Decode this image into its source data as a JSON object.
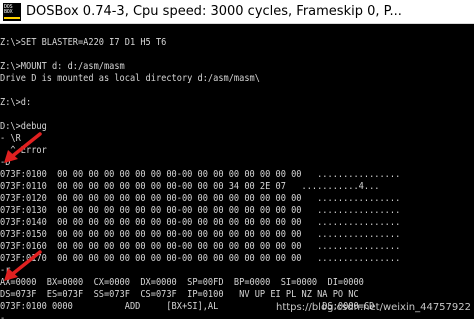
{
  "window": {
    "icon_label_top": "DOS",
    "icon_label_bottom": "BOX",
    "title": "DOSBox 0.74-3, Cpu speed:     3000 cycles, Frameskip  0, P..."
  },
  "console": {
    "lines": [
      "",
      "Z:\\>SET BLASTER=A220 I7 D1 H5 T6",
      "",
      "Z:\\>MOUNT d: d:/asm/masm",
      "Drive D is mounted as local directory d:/asm/masm\\",
      "",
      "Z:\\>d:",
      "",
      "D:\\>debug",
      "- \\R",
      "  ^ Error",
      "-D",
      "073F:0100  00 00 00 00 00 00 00 00-00 00 00 00 00 00 00 00   ................",
      "073F:0110  00 00 00 00 00 00 00 00-00 00 00 34 00 2E 07   ...........4...",
      "073F:0120  00 00 00 00 00 00 00 00-00 00 00 00 00 00 00 00   ................",
      "073F:0130  00 00 00 00 00 00 00 00-00 00 00 00 00 00 00 00   ................",
      "073F:0140  00 00 00 00 00 00 00 00-00 00 00 00 00 00 00 00   ................",
      "073F:0150  00 00 00 00 00 00 00 00-00 00 00 00 00 00 00 00   ................",
      "073F:0160  00 00 00 00 00 00 00 00-00 00 00 00 00 00 00 00   ................",
      "073F:0170  00 00 00 00 00 00 00 00-00 00 00 00 00 00 00 00   ................",
      "-r",
      "AX=0000  BX=0000  CX=0000  DX=0000  SP=00FD  BP=0000  SI=0000  DI=0000",
      "DS=073F  ES=073F  SS=073F  CS=073F  IP=0100   NV UP EI PL NZ NA PO NC",
      "073F:0100 0000          ADD     [BX+SI],AL                    DS:0000=CD",
      "-"
    ]
  },
  "watermark": "https://blog.csdn.net/weixin_44757922",
  "colors": {
    "console_text": "#d6d6d6",
    "console_bg": "#000000",
    "annotation_arrow": "#e02020"
  }
}
